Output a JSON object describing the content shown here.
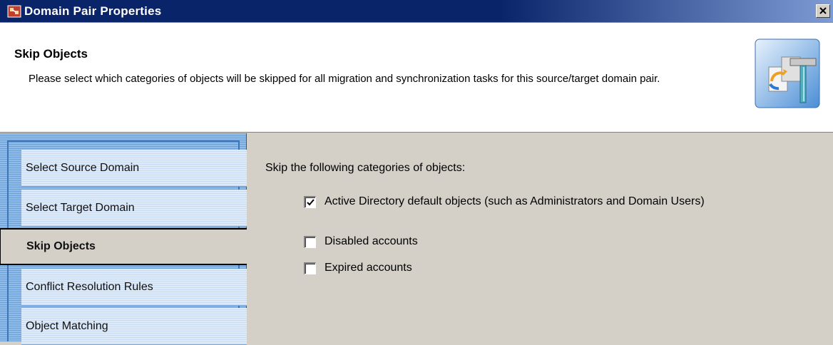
{
  "window": {
    "title": "Domain Pair Properties"
  },
  "header": {
    "title": "Skip Objects",
    "description": "Please select which categories of objects will be skipped for all migration and synchronization tasks for this source/target domain pair."
  },
  "sidebar": {
    "items": [
      {
        "label": "Select Source Domain",
        "active": false
      },
      {
        "label": "Select Target Domain",
        "active": false
      },
      {
        "label": "Skip Objects",
        "active": true
      },
      {
        "label": "Conflict Resolution Rules",
        "active": false
      },
      {
        "label": "Object Matching",
        "active": false
      }
    ]
  },
  "main": {
    "label": "Skip the following categories of objects:",
    "options": [
      {
        "label": "Active Directory default objects (such as Administrators and Domain Users)",
        "checked": true
      },
      {
        "label": "Disabled accounts",
        "checked": false
      },
      {
        "label": "Expired accounts",
        "checked": false
      }
    ]
  },
  "colors": {
    "title_bar": "#0a246a",
    "sidebar": "#6ea0d8",
    "dialog_face": "#d4d0c8"
  },
  "icons": {
    "app": "domain-pair-icon",
    "close": "close-icon",
    "header": "domain-tools-icon"
  }
}
